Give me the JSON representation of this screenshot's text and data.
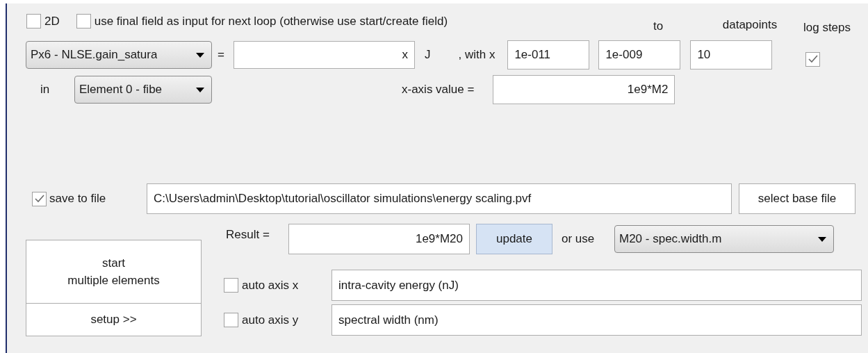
{
  "options": [
    {
      "label": "2D",
      "checked": false
    },
    {
      "label": "use final field as input for next loop (otherwise use start/create field)",
      "checked": false
    }
  ],
  "range_headers": [
    "to",
    "datapoints",
    "log steps"
  ],
  "parameter": {
    "select": "Px6 - NLSE.gain_satura",
    "equals": "=",
    "value": "x",
    "unit": "J",
    "with_label": ", with x"
  },
  "range": {
    "from": "1e-011",
    "to": "1e-009",
    "datapoints": "10",
    "log_steps": true
  },
  "element": {
    "label": "in",
    "select": "Element 0 - fibe"
  },
  "x_axis": {
    "label": "x-axis value =",
    "value": "1e9*M2"
  },
  "save": {
    "label": "save to file",
    "checked": true,
    "path": "C:\\Users\\admin\\Desktop\\tutorial\\oscillator simulations\\energy scaling.pvf",
    "button": "select base file"
  },
  "result": {
    "label": "Result =",
    "value": "1e9*M20",
    "update_button": "update",
    "or_use": "or use",
    "select": "M20 - spec.width.m"
  },
  "start_button": [
    "start",
    "multiple elements"
  ],
  "setup_button": "setup >>",
  "axes": [
    {
      "label": "auto axis x",
      "checked": false,
      "value": "intra-cavity energy (nJ)"
    },
    {
      "label": "auto axis y",
      "checked": false,
      "value": "spectral width (nm)"
    }
  ]
}
